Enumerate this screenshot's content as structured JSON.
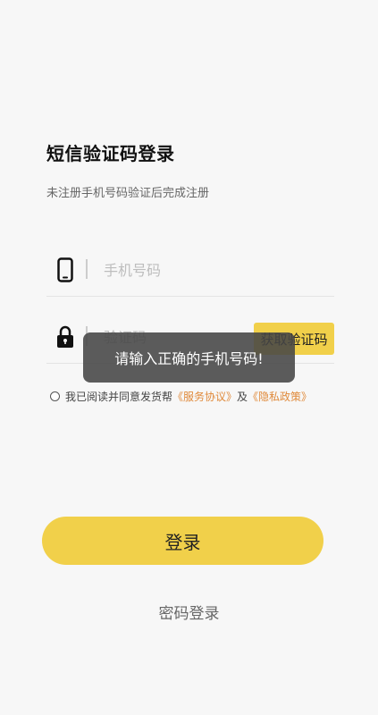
{
  "header": {
    "title": "短信验证码登录",
    "subtitle": "未注册手机号码验证后完成注册"
  },
  "phone": {
    "icon": "phone-icon",
    "placeholder": "手机号码",
    "value": ""
  },
  "code": {
    "icon": "lock-icon",
    "placeholder": "验证码",
    "value": "",
    "get_code_label": "获取验证码"
  },
  "agreement": {
    "prefix": "我已阅读并同意发货帮",
    "service_link": "《服务协议》",
    "and": "及",
    "privacy_link": "《隐私政策》",
    "checked": false
  },
  "login_button": "登录",
  "password_login": "密码登录",
  "toast": "请输入正确的手机号码!",
  "colors": {
    "accent": "#f1d04a",
    "link": "#e08a3b",
    "background": "#f7f7f7"
  }
}
